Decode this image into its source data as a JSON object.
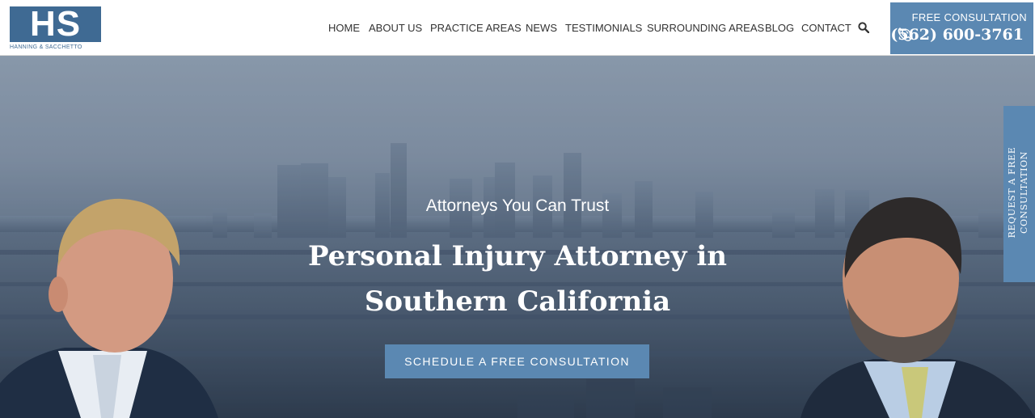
{
  "logo": {
    "initials": "HS",
    "subtitle": "HANNING & SACCHETTO"
  },
  "nav": {
    "items": [
      {
        "label": "HOME"
      },
      {
        "label": "ABOUT US"
      },
      {
        "label": "PRACTICE AREAS"
      },
      {
        "label": "NEWS"
      },
      {
        "label": "TESTIMONIALS"
      },
      {
        "label": "SURROUNDING AREAS"
      },
      {
        "label": "BLOG"
      },
      {
        "label": "CONTACT"
      }
    ],
    "search_icon": "search-icon"
  },
  "header_cta": {
    "label": "FREE CONSULTATION",
    "phone": "(562) 600-3761",
    "icon": "phone-icon"
  },
  "hero": {
    "tagline": "Attorneys You Can Trust",
    "headline": "Personal Injury Attorney in Southern California",
    "button_label": "SCHEDULE A FREE CONSULTATION"
  },
  "side_tab": {
    "label": "REQUEST A FREE CONSULTATION"
  },
  "colors": {
    "brand": "#5b88b2",
    "logo": "#3f6a93",
    "nav_text": "#333333"
  }
}
